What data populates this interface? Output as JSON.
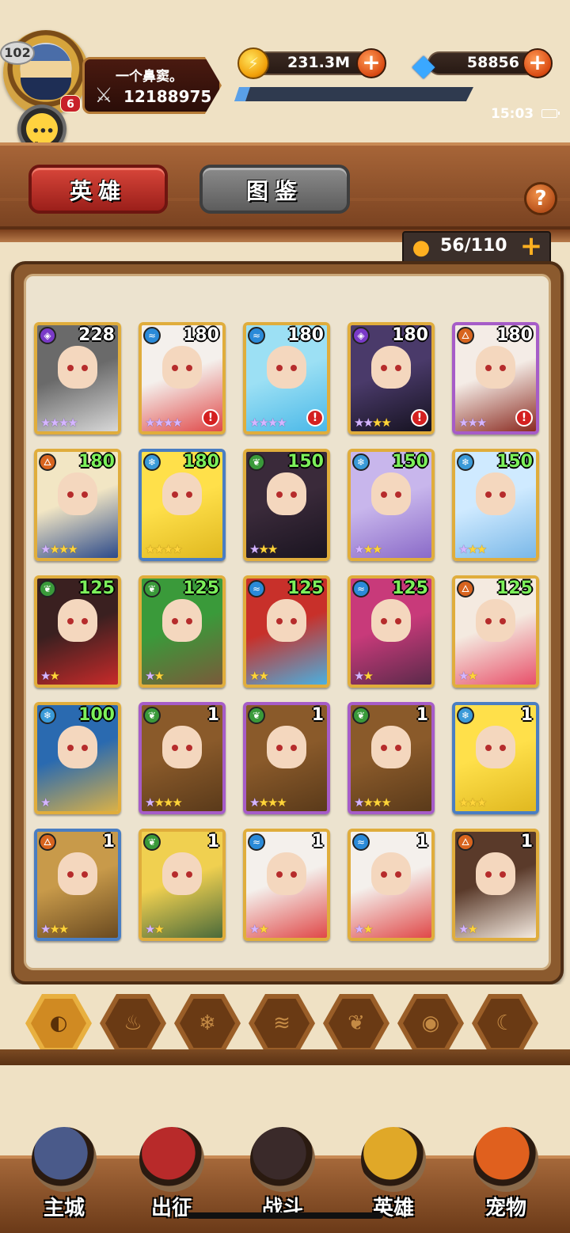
{
  "player": {
    "level": "102",
    "vip": "6",
    "name": "一个鼻窦。",
    "power": "12188975",
    "exp_fraction": 0.06
  },
  "chat_label": "聊天",
  "resources": {
    "gold": "231.3M",
    "gems": "58856"
  },
  "status": {
    "time": "15:03"
  },
  "tabs": [
    {
      "label": "英雄",
      "active": true
    },
    {
      "label": "图鉴",
      "active": false
    }
  ],
  "help_label": "?",
  "capacity": "56/110",
  "heroes": [
    {
      "level": "228",
      "element": "dark",
      "rarity": "gold",
      "stars": 4,
      "purple_stars": 4,
      "alert": false,
      "level_color": "white",
      "art": [
        "#6a6a6a",
        "#d8d8d8"
      ]
    },
    {
      "level": "180",
      "element": "water",
      "rarity": "gold",
      "stars": 4,
      "purple_stars": 4,
      "alert": true,
      "level_color": "white",
      "art": [
        "#f4f0ec",
        "#e04848"
      ]
    },
    {
      "level": "180",
      "element": "water",
      "rarity": "gold",
      "stars": 4,
      "purple_stars": 4,
      "alert": true,
      "level_color": "white",
      "art": [
        "#9ce0f4",
        "#4ab8e8"
      ]
    },
    {
      "level": "180",
      "element": "dark",
      "rarity": "gold",
      "stars": 4,
      "purple_stars": 2,
      "alert": true,
      "level_color": "white",
      "art": [
        "#4a3a6a",
        "#15121f"
      ]
    },
    {
      "level": "180",
      "element": "fire",
      "rarity": "purple",
      "stars": 3,
      "purple_stars": 3,
      "alert": true,
      "level_color": "white",
      "art": [
        "#f4ece6",
        "#8a2a20"
      ]
    },
    {
      "level": "180",
      "element": "fire",
      "rarity": "gold",
      "stars": 4,
      "purple_stars": 1,
      "alert": false,
      "level_color": "green",
      "art": [
        "#f2e6c4",
        "#2c4a8a"
      ]
    },
    {
      "level": "180",
      "element": "ice",
      "rarity": "blue",
      "stars": 4,
      "purple_stars": 0,
      "alert": false,
      "level_color": "green",
      "art": [
        "#ffe04a",
        "#e0b820"
      ]
    },
    {
      "level": "150",
      "element": "earth",
      "rarity": "gold",
      "stars": 3,
      "purple_stars": 1,
      "alert": false,
      "level_color": "green",
      "art": [
        "#3a2a3a",
        "#1a1420"
      ]
    },
    {
      "level": "150",
      "element": "ice",
      "rarity": "gold",
      "stars": 3,
      "purple_stars": 1,
      "alert": false,
      "level_color": "green",
      "art": [
        "#c8b6ec",
        "#8a6ac8"
      ]
    },
    {
      "level": "150",
      "element": "ice",
      "rarity": "gold",
      "stars": 3,
      "purple_stars": 1,
      "alert": false,
      "level_color": "green",
      "art": [
        "#cfeaff",
        "#7ab8e8"
      ]
    },
    {
      "level": "125",
      "element": "earth",
      "rarity": "gold",
      "stars": 2,
      "purple_stars": 1,
      "alert": false,
      "level_color": "green",
      "art": [
        "#3a2020",
        "#c82a2a"
      ]
    },
    {
      "level": "125",
      "element": "earth",
      "rarity": "gold",
      "stars": 2,
      "purple_stars": 1,
      "alert": false,
      "level_color": "green",
      "art": [
        "#3a9a3a",
        "#7a5a3a"
      ]
    },
    {
      "level": "125",
      "element": "water",
      "rarity": "gold",
      "stars": 2,
      "purple_stars": 0,
      "alert": false,
      "level_color": "green",
      "art": [
        "#c8302a",
        "#4ab0e0"
      ]
    },
    {
      "level": "125",
      "element": "water",
      "rarity": "gold",
      "stars": 2,
      "purple_stars": 1,
      "alert": false,
      "level_color": "green",
      "art": [
        "#c83a7a",
        "#5a2a4a"
      ]
    },
    {
      "level": "125",
      "element": "fire",
      "rarity": "gold",
      "stars": 2,
      "purple_stars": 1,
      "alert": false,
      "level_color": "green",
      "art": [
        "#f4eae0",
        "#e8506a"
      ]
    },
    {
      "level": "100",
      "element": "ice",
      "rarity": "gold",
      "stars": 1,
      "purple_stars": 1,
      "alert": false,
      "level_color": "green",
      "art": [
        "#2a6ab0",
        "#d8b048"
      ]
    },
    {
      "level": "1",
      "element": "earth",
      "rarity": "purple",
      "stars": 4,
      "purple_stars": 1,
      "alert": false,
      "level_color": "white",
      "art": [
        "#8a5a2a",
        "#5a3a1a"
      ]
    },
    {
      "level": "1",
      "element": "earth",
      "rarity": "purple",
      "stars": 4,
      "purple_stars": 1,
      "alert": false,
      "level_color": "white",
      "art": [
        "#8a5a2a",
        "#5a3a1a"
      ]
    },
    {
      "level": "1",
      "element": "earth",
      "rarity": "purple",
      "stars": 4,
      "purple_stars": 1,
      "alert": false,
      "level_color": "white",
      "art": [
        "#8a5a2a",
        "#5a3a1a"
      ]
    },
    {
      "level": "1",
      "element": "ice",
      "rarity": "blue",
      "stars": 3,
      "purple_stars": 0,
      "alert": false,
      "level_color": "white",
      "art": [
        "#ffe04a",
        "#e0b820"
      ]
    },
    {
      "level": "1",
      "element": "fire",
      "rarity": "blue",
      "stars": 3,
      "purple_stars": 1,
      "alert": false,
      "level_color": "white",
      "art": [
        "#c89a4a",
        "#6a4a20"
      ]
    },
    {
      "level": "1",
      "element": "earth",
      "rarity": "gold",
      "stars": 2,
      "purple_stars": 1,
      "alert": false,
      "level_color": "white",
      "art": [
        "#f0d050",
        "#4a6a3a"
      ]
    },
    {
      "level": "1",
      "element": "water",
      "rarity": "gold",
      "stars": 2,
      "purple_stars": 1,
      "alert": false,
      "level_color": "white",
      "art": [
        "#f4f0ec",
        "#e04848"
      ]
    },
    {
      "level": "1",
      "element": "water",
      "rarity": "gold",
      "stars": 2,
      "purple_stars": 1,
      "alert": false,
      "level_color": "white",
      "art": [
        "#f4f0ec",
        "#e04848"
      ]
    },
    {
      "level": "1",
      "element": "fire",
      "rarity": "gold",
      "stars": 2,
      "purple_stars": 1,
      "alert": false,
      "level_color": "white",
      "art": [
        "#5a3a2a",
        "#f4eae0"
      ]
    }
  ],
  "element_icons": {
    "fire": "🜂",
    "water": "≈",
    "ice": "❄",
    "earth": "❦",
    "dark": "◈"
  },
  "element_colors": {
    "fire": "#d8641e",
    "water": "#2a8ad8",
    "ice": "#3a9ad8",
    "earth": "#3a9a3a",
    "dark": "#7a3ac8"
  },
  "filters": [
    {
      "name": "all-filter",
      "glyph": "◐",
      "active": true
    },
    {
      "name": "fire-filter",
      "glyph": "♨",
      "active": false
    },
    {
      "name": "ice-filter",
      "glyph": "❄",
      "active": false
    },
    {
      "name": "water-filter",
      "glyph": "≋",
      "active": false
    },
    {
      "name": "earth-filter",
      "glyph": "❦",
      "active": false
    },
    {
      "name": "dark-filter",
      "glyph": "◉",
      "active": false
    },
    {
      "name": "light-filter",
      "glyph": "☾",
      "active": false
    }
  ],
  "nav": [
    {
      "label": "主城",
      "icon": "castle-icon",
      "color": "#4a5a8a"
    },
    {
      "label": "出征",
      "icon": "expedition-icon",
      "color": "#b82a2a"
    },
    {
      "label": "战斗",
      "icon": "battle-icon",
      "color": "#3a2a2a"
    },
    {
      "label": "英雄",
      "icon": "hero-icon",
      "color": "#e0a828"
    },
    {
      "label": "宠物",
      "icon": "pet-icon",
      "color": "#e0601e"
    }
  ]
}
